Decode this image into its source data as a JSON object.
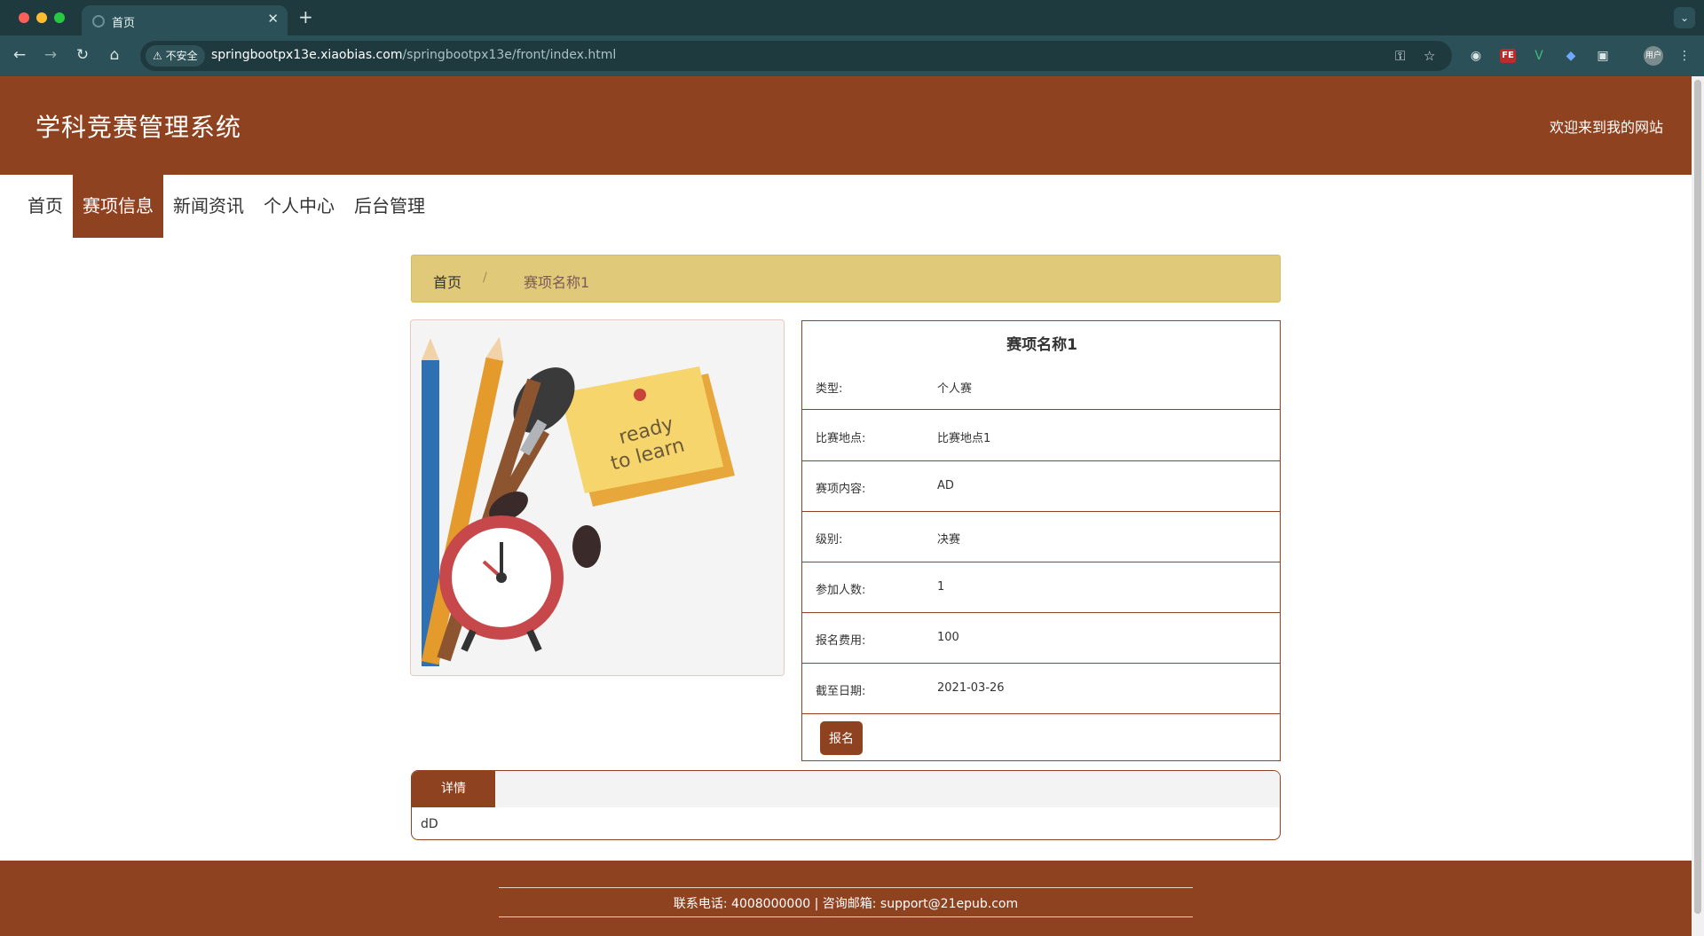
{
  "browser": {
    "tab_title": "首页",
    "security_label": "不安全",
    "url_host": "springbootpx13e.xiaobias.com",
    "url_path": "/springbootpx13e/front/index.html",
    "profile_label": "用户"
  },
  "header": {
    "site_title": "学科竞赛管理系统",
    "welcome": "欢迎来到我的网站"
  },
  "nav": {
    "items": [
      {
        "label": "首页",
        "active": false
      },
      {
        "label": "赛项信息",
        "active": true
      },
      {
        "label": "新闻资讯",
        "active": false
      },
      {
        "label": "个人中心",
        "active": false
      },
      {
        "label": "后台管理",
        "active": false
      }
    ]
  },
  "breadcrumb": {
    "home": "首页",
    "separator": "/",
    "current": "赛项名称1"
  },
  "image": {
    "note_line1": "ready",
    "note_line2": "to learn"
  },
  "detail": {
    "title": "赛项名称1",
    "rows": [
      {
        "label": "类型:",
        "value": "个人赛"
      },
      {
        "label": "比赛地点:",
        "value": "比赛地点1"
      },
      {
        "label": "赛项内容:",
        "value": "AD"
      },
      {
        "label": "级别:",
        "value": "决赛"
      },
      {
        "label": "参加人数:",
        "value": "1"
      },
      {
        "label": "报名费用:",
        "value": "100"
      },
      {
        "label": "截至日期:",
        "value": "2021-03-26"
      }
    ],
    "signup_label": "报名"
  },
  "tabs": {
    "detail_label": "详情",
    "detail_content": "dD"
  },
  "footer": {
    "text": "联系电话: 4008000000 | 咨询邮箱: support@21epub.com"
  },
  "colors": {
    "brand": "#8f4220",
    "breadcrumb_bg": "#e0c978",
    "browser_chrome": "#2b5057"
  }
}
